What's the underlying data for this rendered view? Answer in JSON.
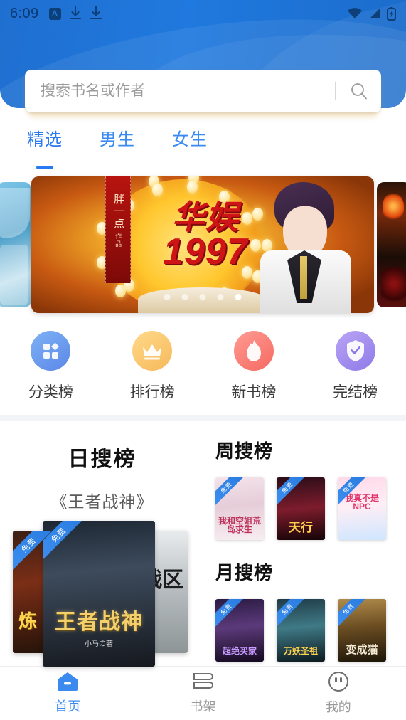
{
  "status_bar": {
    "time": "6:09",
    "icons_left": [
      "app-badge-icon",
      "download-icon",
      "download-icon"
    ],
    "icons_right": [
      "wifi-icon",
      "signal-icon",
      "battery-icon"
    ]
  },
  "search": {
    "placeholder": "搜索书名或作者",
    "value": "",
    "icon": "search-icon"
  },
  "tabs": [
    {
      "label": "精选",
      "active": true
    },
    {
      "label": "男生",
      "active": false
    },
    {
      "label": "女生",
      "active": false
    }
  ],
  "banner": {
    "side_label": "胖一点",
    "side_label_small": "作品",
    "title": "华娱",
    "year": "1997",
    "dots": 5,
    "active_dot": 4
  },
  "quicknav": [
    {
      "label": "分类榜",
      "icon": "grid-icon",
      "color": "#5b87e8"
    },
    {
      "label": "排行榜",
      "icon": "crown-icon",
      "color": "#f6b95a"
    },
    {
      "label": "新书榜",
      "icon": "flame-icon",
      "color": "#f56a62"
    },
    {
      "label": "完结榜",
      "icon": "shield-check-icon",
      "color": "#8f79e8"
    }
  ],
  "daily_rank": {
    "title": "日搜榜",
    "subtitle": "《王者战神》",
    "badge": "免费",
    "covers": [
      {
        "title": "炼",
        "position": "left"
      },
      {
        "title": "王者战神",
        "author": "小马の著",
        "position": "center"
      },
      {
        "title": "战区",
        "position": "right"
      }
    ]
  },
  "weekly_rank": {
    "title": "周搜榜",
    "badge": "免费",
    "books": [
      {
        "title": "我和空姐荒岛求生"
      },
      {
        "title": "天行"
      },
      {
        "title": "我真不是NPC"
      }
    ]
  },
  "monthly_rank": {
    "title": "月搜榜",
    "badge": "免费",
    "books": [
      {
        "title": "超绝买家"
      },
      {
        "title": "万妖圣祖"
      },
      {
        "title": "变成猫"
      }
    ]
  },
  "bottom_nav": [
    {
      "label": "首页",
      "icon": "home-icon",
      "active": true
    },
    {
      "label": "书架",
      "icon": "bookshelf-icon",
      "active": false
    },
    {
      "label": "我的",
      "icon": "profile-icon",
      "active": false
    }
  ],
  "colors": {
    "brand_blue": "#2079de",
    "accent_blue": "#3a8af0",
    "free_badge": "#2a7bdf"
  }
}
